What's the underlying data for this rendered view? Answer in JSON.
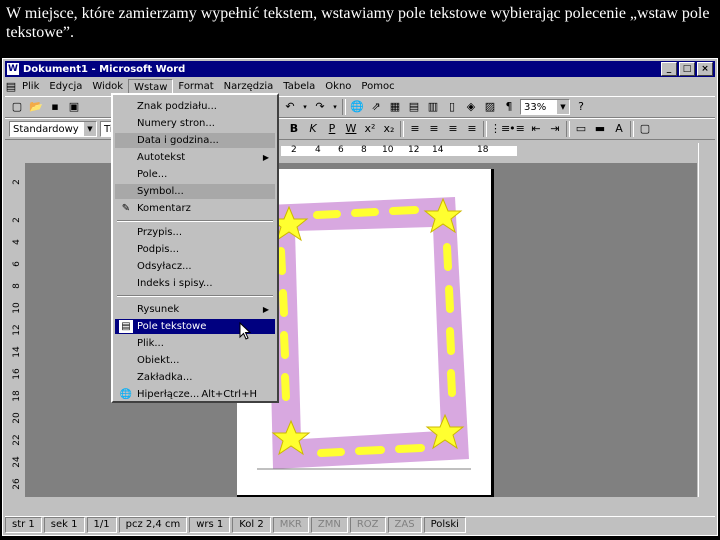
{
  "caption": "W miejsce, które zamierzamy wypełnić tekstem, wstawiamy pole tekstowe wybierając polecenie „wstaw pole tekstowe”.",
  "window": {
    "title": "Dokument1 - Microsoft Word",
    "buttons": [
      "_",
      "□",
      "×"
    ]
  },
  "menubar": [
    "Plik",
    "Edycja",
    "Widok",
    "Wstaw",
    "Format",
    "Narzędzia",
    "Tabela",
    "Okno",
    "Pomoc"
  ],
  "toolbar": {
    "style": "Standardowy",
    "font": "Ti",
    "zoom": "33%"
  },
  "ruler": {
    "h": [
      "2",
      "4",
      "6",
      "8",
      "10",
      "12",
      "14",
      "18"
    ],
    "v": [
      "2",
      "2",
      "4",
      "6",
      "8",
      "10",
      "12",
      "14",
      "16",
      "18",
      "20",
      "22",
      "24",
      "26"
    ]
  },
  "insert_menu": {
    "items": [
      {
        "label": "Znak podziału...",
        "shortcut": "",
        "sub": false
      },
      {
        "label": "Numery stron...",
        "shortcut": "",
        "sub": false
      },
      {
        "label": "Data i godzina...",
        "shortcut": "",
        "sub": false
      },
      {
        "label": "Autotekst",
        "shortcut": "",
        "sub": true
      },
      {
        "label": "Pole...",
        "shortcut": "",
        "sub": false
      },
      {
        "label": "Symbol...",
        "shortcut": "",
        "sub": false
      },
      {
        "label": "Komentarz",
        "shortcut": "",
        "sub": false
      },
      {
        "label": "Przypis...",
        "shortcut": "",
        "sub": false
      },
      {
        "label": "Podpis...",
        "shortcut": "",
        "sub": false
      },
      {
        "label": "Odsyłacz...",
        "shortcut": "",
        "sub": false
      },
      {
        "label": "Indeks i spisy...",
        "shortcut": "",
        "sub": false
      },
      {
        "label": "Rysunek",
        "shortcut": "",
        "sub": true
      },
      {
        "label": "Pole tekstowe",
        "shortcut": "",
        "sub": false
      },
      {
        "label": "Plik...",
        "shortcut": "",
        "sub": false
      },
      {
        "label": "Obiekt...",
        "shortcut": "",
        "sub": false
      },
      {
        "label": "Zakładka...",
        "shortcut": "",
        "sub": false
      },
      {
        "label": "Hiperłącze...",
        "shortcut": "Alt+Ctrl+H",
        "sub": false
      }
    ]
  },
  "statusbar": {
    "str": "str 1",
    "sek": "sek 1",
    "pages": "1/1",
    "pos": "pcz 2,4 cm",
    "line": "wrs 1",
    "col": "Kol 2",
    "mkr": "MKR",
    "zmn": "ZMN",
    "roz": "ROZ",
    "zas": "ZAS",
    "lang": "Polski"
  },
  "colors": {
    "titlebar": "#000080",
    "frame_pink": "#d8a8e0",
    "frame_yellow": "#ffff30"
  }
}
